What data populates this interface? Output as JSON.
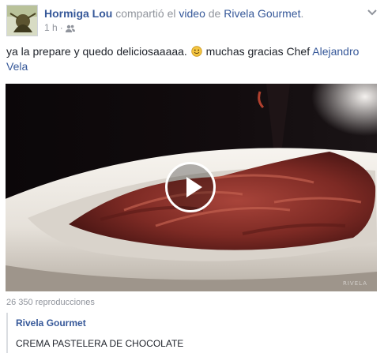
{
  "post": {
    "author": "Hormiga Lou",
    "action": "compartió el",
    "object": "video",
    "preposition": "de",
    "page": "Rivela Gourmet",
    "period": ".",
    "timestamp": "1 h",
    "separator": "·",
    "audience_icon": "friends-icon",
    "menu_icon": "chevron-down-icon"
  },
  "message": {
    "text_before": "ya la prepare y quedo deliciosaaaaa.",
    "emoji": "smiley-emoji",
    "text_after": "muchas gracias Chef",
    "mention": "Alejandro Vela"
  },
  "video": {
    "play_icon": "play-icon",
    "watermark": "RIVELA",
    "views": "26 350 reproducciones"
  },
  "attachment": {
    "source": "Rivela Gourmet",
    "title": "CREMA PASTELERA DE CHOCOLATE"
  }
}
